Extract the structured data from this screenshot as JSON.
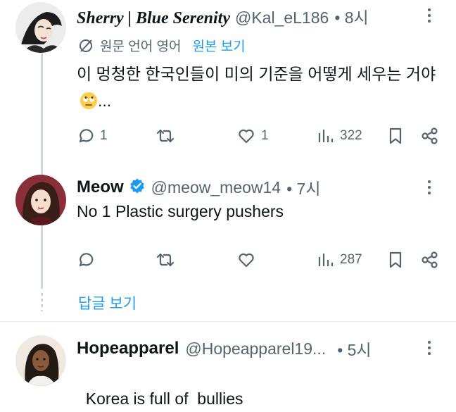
{
  "tweets": [
    {
      "display_name": "Sherry | Blue Serenity",
      "handle": "@Kal_eL186",
      "time": "• 8시",
      "translate_source": "원문 언어 영어",
      "translate_link": "원본 보기",
      "text": "이 멍청한 한국인들이 미의 기준을 어떻게 세우는 거야",
      "text_suffix": "...",
      "emoji": "face-with-rolling-eyes",
      "replies": "1",
      "retweets": "",
      "likes": "1",
      "views": "322"
    },
    {
      "display_name": "Meow",
      "verified": true,
      "handle": "@meow_meow14",
      "time": "• 7시",
      "text": "No 1 Plastic surgery pushers",
      "replies": "",
      "retweets": "",
      "likes": "",
      "views": "287"
    },
    {
      "display_name": "Hopeapparel",
      "handle": "@Hopeapparel19...",
      "time": "• 5시",
      "text": "Korea is full of  bullies"
    }
  ],
  "show_replies_label": "답글 보기",
  "colors": {
    "accent": "#1d9bf0",
    "secondary_text": "#536471",
    "verified": "#1d9bf0"
  }
}
